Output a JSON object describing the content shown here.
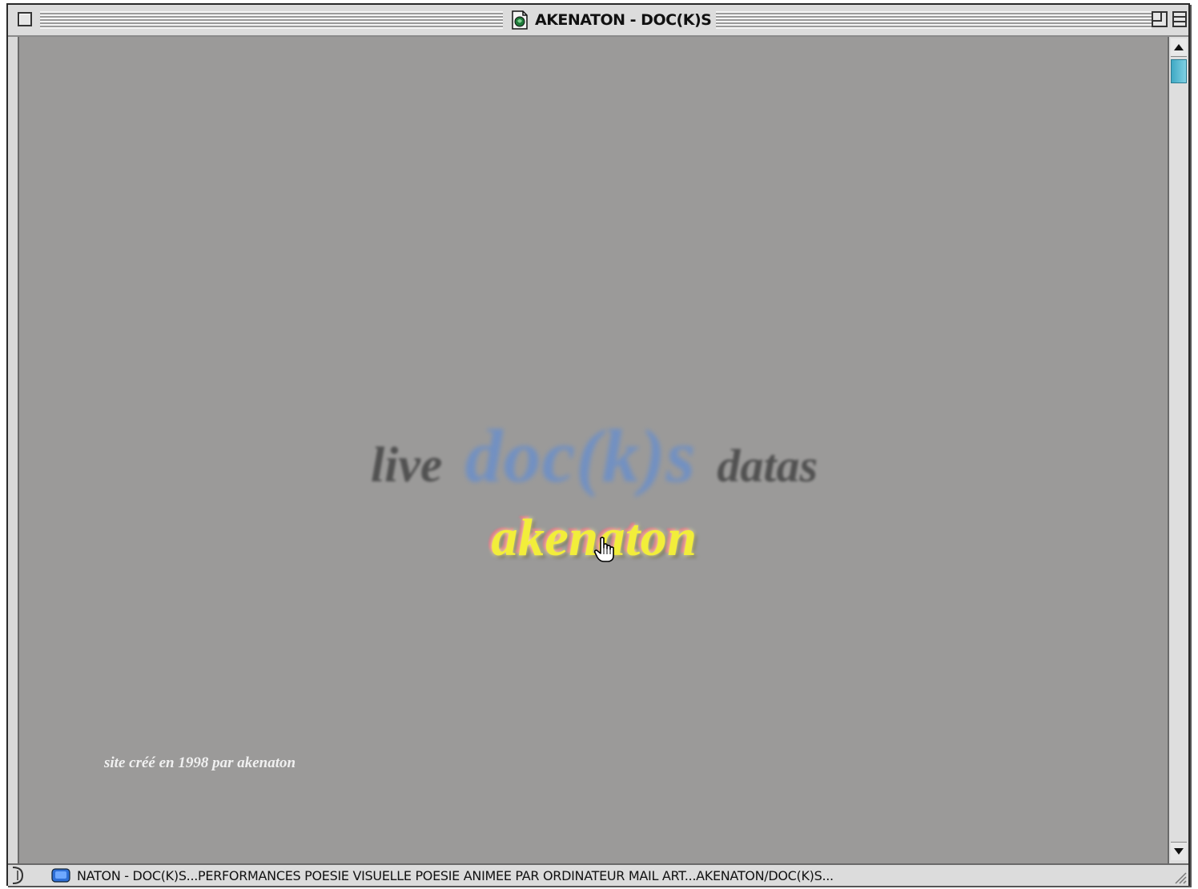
{
  "window": {
    "title": "AKENATON - DOC(K)S"
  },
  "page": {
    "headline": {
      "left_word": "live",
      "center_word": "doc(k)s",
      "right_word": "datas"
    },
    "link_label": "akenaton",
    "credit": "site créé en 1998 par akenaton"
  },
  "statusbar": {
    "text": "NATON - DOC(K)S...PERFORMANCES POESIE VISUELLE POESIE ANIMEE PAR ORDINATEUR MAIL ART...AKENATON/DOC(K)S..."
  },
  "icons": {
    "close": "close-box-icon",
    "document": "document-icon",
    "zoom": "zoom-box-icon",
    "collapse": "collapse-box-icon",
    "scroll_up": "arrow-up-icon",
    "scroll_down": "arrow-down-icon",
    "globe": "globe-icon",
    "cursor": "hand-cursor-icon",
    "grow": "resize-grip-icon"
  },
  "colors": {
    "background": "#9b9a99",
    "docks_blue": "#6b8fc9",
    "link_yellow": "#f2ee3a",
    "scroll_thumb": "#3fa9c4"
  }
}
